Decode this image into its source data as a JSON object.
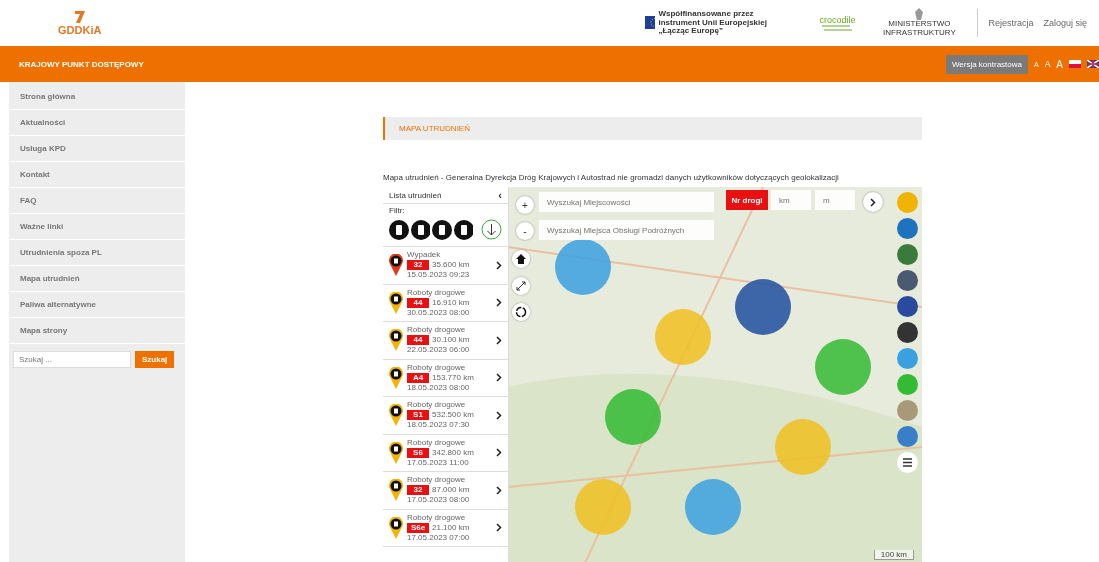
{
  "header": {
    "logo_text": "GDDKiA",
    "eu_text": "Współfinansowane przez instrument Unii Europejskiej „Łącząc Europę”",
    "crocodile_text": "crocodile",
    "ministry_text": "MINISTERSTWO INFRASTRUKTURY",
    "links": [
      "Rejestracja",
      "Zaloguj się"
    ]
  },
  "topbar": {
    "title": "KRAJOWY PUNKT DOSTĘPOWY",
    "contrast_button": "Wersja kontrastowa",
    "font_sizes": [
      "A",
      "A",
      "A"
    ]
  },
  "sidebar": {
    "items": [
      {
        "label": "Strona główna",
        "selected": false
      },
      {
        "label": "Aktualności",
        "selected": false
      },
      {
        "label": "Usługa KPD",
        "selected": false
      },
      {
        "label": "Kontakt",
        "selected": false
      },
      {
        "label": "FAQ",
        "selected": false
      },
      {
        "label": "Ważne linki",
        "selected": false
      },
      {
        "label": "Utrudnienia spoza PL",
        "selected": false
      },
      {
        "label": "Mapa utrudnień",
        "selected": false
      },
      {
        "label": "Paliwa alternatywne",
        "selected": false
      },
      {
        "label": "Mapa strony",
        "selected": false
      }
    ],
    "search": {
      "placeholder": "Szukaj ...",
      "button": "Szukaj"
    }
  },
  "breadcrumb": "MAPA UTRUDNIEŃ",
  "caption": "Mapa utrudnień - Generalna Dyrekcja Dróg Krajowych i Autostrad nie gromadzi danych użytkowników dotyczących geolokalizacji",
  "list": {
    "title": "Lista utrudnień",
    "collapse": "‹",
    "filter_label": "Filtr:",
    "items": [
      {
        "kind": "accident",
        "type": "Wypadek",
        "road": "32",
        "km": "35.600 km",
        "date": "15.05.2023 09:23"
      },
      {
        "kind": "roadworks",
        "type": "Roboty drogowe",
        "road": "44",
        "km": "16.910 km",
        "date": "30.05.2023 08:00"
      },
      {
        "kind": "roadworks",
        "type": "Roboty drogowe",
        "road": "44",
        "km": "30.100 km",
        "date": "22.05.2023 06:00"
      },
      {
        "kind": "roadworks",
        "type": "Roboty drogowe",
        "road": "A4",
        "km": "153.770 km",
        "date": "18.05.2023 08:00"
      },
      {
        "kind": "roadworks",
        "type": "Roboty drogowe",
        "road": "S1",
        "km": "532.500 km",
        "date": "18.05.2023 07:30"
      },
      {
        "kind": "roadworks",
        "type": "Roboty drogowe",
        "road": "S6",
        "km": "342.800 km",
        "date": "17.05.2023 11:00"
      },
      {
        "kind": "roadworks",
        "type": "Roboty drogowe",
        "road": "32",
        "km": "87.000 km",
        "date": "17.05.2023 08:00"
      },
      {
        "kind": "roadworks",
        "type": "Roboty drogowe",
        "road": "S6e",
        "km": "21.100 km",
        "date": "17.05.2023 07:00"
      }
    ]
  },
  "map": {
    "zoom_in": "+",
    "zoom_out": "-",
    "search_place": {
      "placeholder": "Wyszukaj Miejscowości"
    },
    "search_mop": {
      "placeholder": "Wyszukaj Miejsca Obsługi Podróżnych"
    },
    "road_button": "Nr drogi",
    "km_placeholder": "km",
    "m_placeholder": "m",
    "scale": "100 km",
    "layers": [
      {
        "color": "#f0b400"
      },
      {
        "color": "#1e73be"
      },
      {
        "color": "#3a7a3a"
      },
      {
        "color": "#4a5a70"
      },
      {
        "color": "#2a4aa0"
      },
      {
        "color": "#333333"
      },
      {
        "color": "#3aa0e0"
      },
      {
        "color": "#33bb33"
      },
      {
        "color": "#a89a78"
      },
      {
        "color": "#3a7ec8"
      }
    ]
  }
}
